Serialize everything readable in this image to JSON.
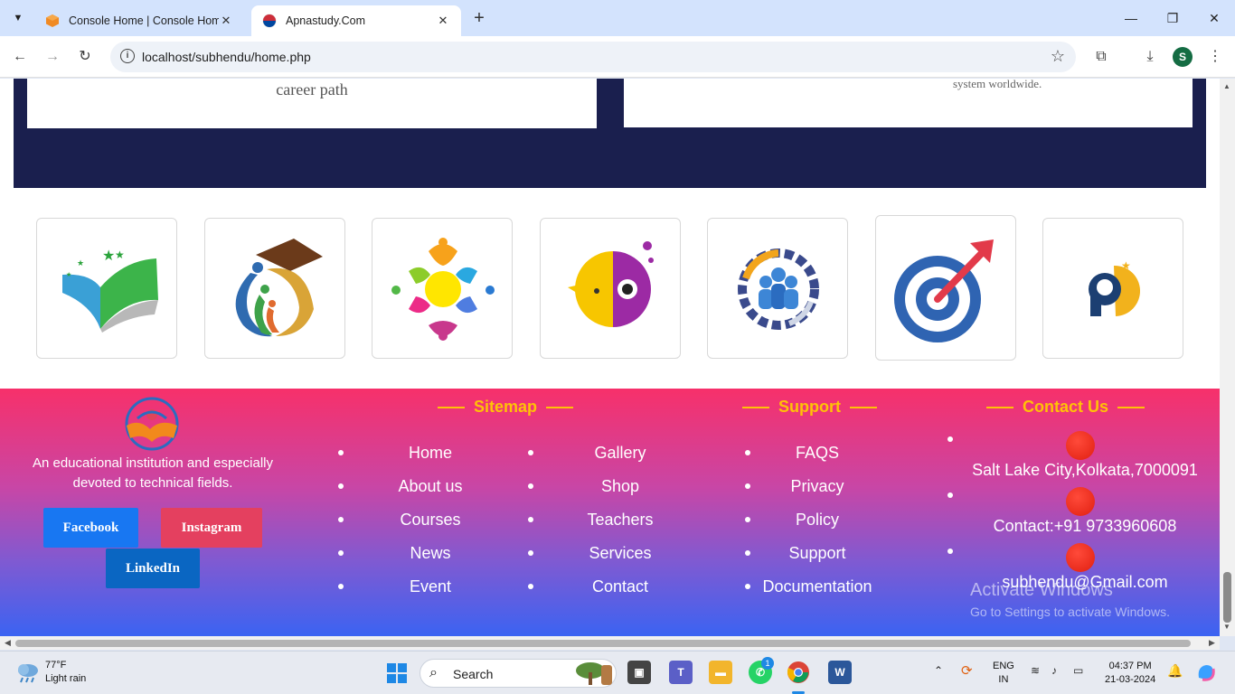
{
  "browser": {
    "tabs": [
      {
        "title": "Console Home | Console Home"
      },
      {
        "title": "Apnastudy.Com"
      }
    ],
    "url": "localhost/subhendu/home.php",
    "profile_initial": "S"
  },
  "page": {
    "card_left_text": "career path",
    "card_right_text": "system worldwide.",
    "footer": {
      "about": "An educational institution and especially devoted to technical fields.",
      "social": {
        "facebook": "Facebook",
        "instagram": "Instagram",
        "linkedin": "LinkedIn"
      },
      "sitemap": {
        "title": "Sitemap",
        "col1": [
          "Home",
          "About us",
          "Courses",
          "News",
          "Event"
        ],
        "col2": [
          "Gallery",
          "Shop",
          "Teachers",
          "Services",
          "Contact"
        ]
      },
      "support": {
        "title": "Support",
        "items": [
          "FAQS",
          "Privacy",
          "Policy",
          "Support",
          "Documentation"
        ]
      },
      "contact": {
        "title": "Contact Us",
        "items": [
          "Salt Lake City,Kolkata,7000091",
          "Contact:+91 9733960608",
          "subhendu@Gmail.com"
        ]
      }
    },
    "watermark": {
      "line1": "Activate Windows",
      "line2": "Go to Settings to activate Windows."
    }
  },
  "taskbar": {
    "weather_temp": "77°F",
    "weather_desc": "Light rain",
    "search_label": "Search",
    "whatsapp_badge": "1",
    "lang_top": "ENG",
    "lang_bottom": "IN",
    "time": "04:37 PM",
    "date": "21-03-2024"
  },
  "colors": {
    "navy": "#1a1f4e",
    "footer_top": "#f7306a",
    "footer_bottom": "#3b63f2",
    "heading_gold": "#ffc107"
  }
}
